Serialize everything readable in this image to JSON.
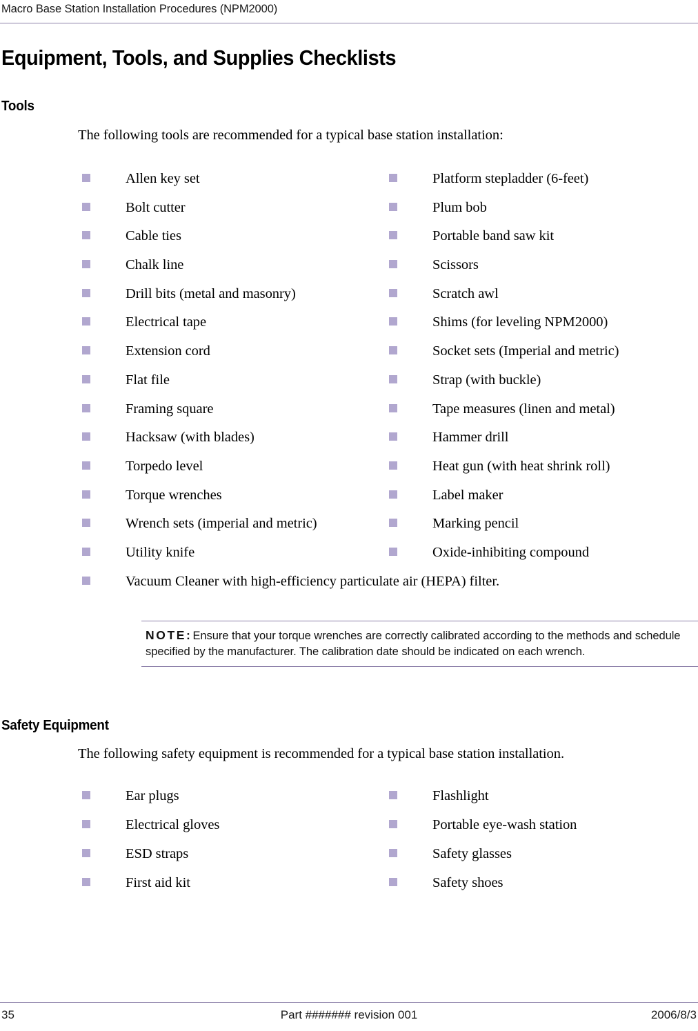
{
  "header": {
    "running_head": "Macro Base Station Installation Procedures (NPM2000)"
  },
  "document": {
    "title": "Equipment, Tools, and Supplies Checklists"
  },
  "tools_section": {
    "heading": "Tools",
    "intro": "The following tools are recommended for a typical base station installation:",
    "rows": [
      {
        "left": "Allen key set",
        "right": "Platform stepladder (6-feet)"
      },
      {
        "left": "Bolt cutter",
        "right": "Plum bob"
      },
      {
        "left": "Cable ties",
        "right": "Portable band saw kit"
      },
      {
        "left": "Chalk line",
        "right": "Scissors"
      },
      {
        "left": "Drill bits (metal and masonry)",
        "right": "Scratch awl"
      },
      {
        "left": "Electrical tape",
        "right": "Shims (for leveling NPM2000)"
      },
      {
        "left": "Extension cord",
        "right": "Socket sets (Imperial and metric)"
      },
      {
        "left": "Flat file",
        "right": "Strap (with buckle)"
      },
      {
        "left": "Framing square",
        "right": "Tape measures (linen and metal)"
      },
      {
        "left": "Hacksaw (with blades)",
        "right": "Hammer drill"
      },
      {
        "left": "Torpedo level",
        "right": "Heat gun (with heat shrink roll)"
      },
      {
        "left": "Torque wrenches",
        "right": "Label maker"
      },
      {
        "left": "Wrench sets (imperial and metric)",
        "right": "Marking pencil"
      },
      {
        "left": "Utility knife",
        "right": "Oxide-inhibiting compound"
      }
    ],
    "full_width_item": "Vacuum Cleaner with high-efficiency particulate air (HEPA) filter."
  },
  "note": {
    "label": "NOTE:",
    "text": "Ensure that your torque wrenches are correctly calibrated according to the methods and schedule specified by the manufacturer. The calibration date should be indicated on each wrench."
  },
  "safety_section": {
    "heading": "Safety Equipment",
    "intro": "The following safety equipment is recommended for a typical base station installation.",
    "rows": [
      {
        "left": "Ear plugs",
        "right": "Flashlight"
      },
      {
        "left": "Electrical gloves",
        "right": "Portable eye-wash station"
      },
      {
        "left": "ESD straps",
        "right": "Safety glasses"
      },
      {
        "left": "First aid kit",
        "right": "Safety shoes"
      }
    ]
  },
  "footer": {
    "page_number": "35",
    "part_revision": "Part ####### revision 001",
    "date": "2006/8/3"
  },
  "colors": {
    "rule": "#8b7fa8",
    "bullet": "#b1a7cf",
    "text": "#000000"
  }
}
